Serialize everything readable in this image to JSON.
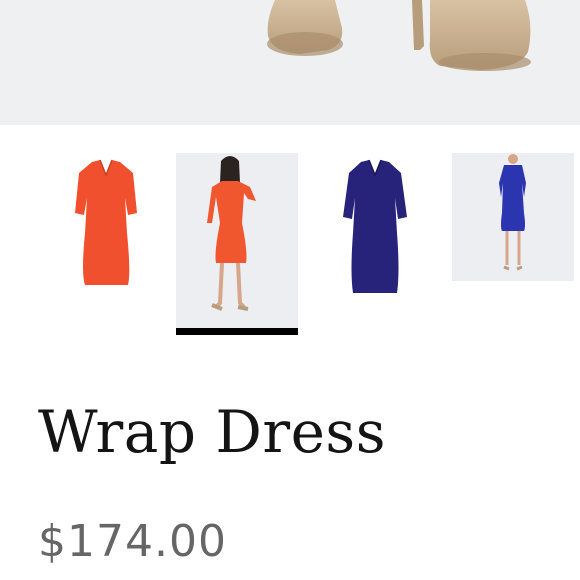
{
  "hero": {
    "image": "shoes-heels-closeup"
  },
  "thumbnails": [
    {
      "image": "orange-dress-flat",
      "color": "#f0502e"
    },
    {
      "image": "orange-dress-model",
      "color": "#f0572f",
      "selected": true
    },
    {
      "image": "navy-dress-flat",
      "color": "#28237a"
    },
    {
      "image": "blue-dress-model",
      "color": "#2b35b0"
    }
  ],
  "product": {
    "title": "Wrap Dress",
    "price": "$174.00"
  }
}
